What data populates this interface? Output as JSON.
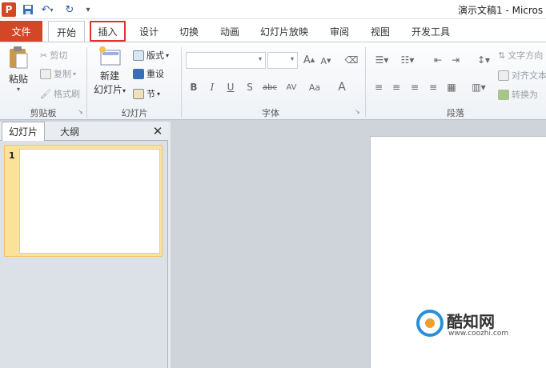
{
  "app": {
    "icon_letter": "P",
    "title": "演示文稿1 - Micros"
  },
  "qat": {
    "save_icon": "save-icon",
    "undo_icon": "undo-icon",
    "redo_icon": "redo-icon"
  },
  "tabs": [
    {
      "label": "文件"
    },
    {
      "label": "开始"
    },
    {
      "label": "插入"
    },
    {
      "label": "设计"
    },
    {
      "label": "切换"
    },
    {
      "label": "动画"
    },
    {
      "label": "幻灯片放映"
    },
    {
      "label": "审阅"
    },
    {
      "label": "视图"
    },
    {
      "label": "开发工具"
    }
  ],
  "ribbon": {
    "clipboard": {
      "paste": "粘贴",
      "cut": "剪切",
      "copy": "复制",
      "format_painter": "格式刷",
      "label": "剪贴板"
    },
    "slides": {
      "new_line1": "新建",
      "new_line2": "幻灯片",
      "layout": "版式",
      "reset": "重设",
      "section": "节",
      "label": "幻灯片"
    },
    "font": {
      "label": "字体",
      "bold": "B",
      "italic": "I",
      "underline": "U",
      "shadow": "S",
      "strike": "abc",
      "spacing": "AV",
      "case": "Aa",
      "color": "A",
      "grow": "A",
      "shrink": "A"
    },
    "paragraph": {
      "text_direction": "文字方向",
      "align_text": "对齐文本",
      "convert": "转换为",
      "label": "段落"
    }
  },
  "panel": {
    "tab_slides": "幻灯片",
    "tab_outline": "大纲",
    "slide_number": "1"
  },
  "watermark": {
    "brand": "酷知网",
    "url": "www.coozhi.com"
  },
  "colors": {
    "file_tab": "#d24726",
    "highlight": "#e2312c",
    "selected_thumb": "#fbe29a"
  }
}
